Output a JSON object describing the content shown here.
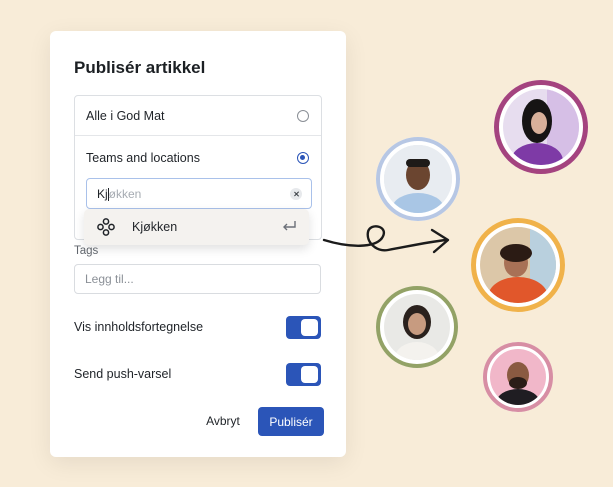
{
  "dialog": {
    "title": "Publisér artikkel",
    "audience_options": [
      {
        "label": "Alle i God Mat",
        "selected": false
      },
      {
        "label": "Teams and locations",
        "selected": true
      }
    ],
    "search": {
      "typed": "Kj",
      "suggestion_rest": "økken"
    },
    "suggestion": {
      "label": "Kjøkken",
      "icon": "team-icon",
      "action_icon": "return-icon"
    },
    "tags": {
      "label": "Tags",
      "placeholder": "Legg til..."
    },
    "toggles": [
      {
        "label": "Vis innholdsfortegnelse",
        "on": true
      },
      {
        "label": "Send push-varsel",
        "on": true
      }
    ],
    "cancel_label": "Avbryt",
    "publish_label": "Publisér"
  },
  "colors": {
    "background": "#f8ecd8",
    "accent": "#2b55b8",
    "avatar_rings": [
      "#b7c7e4",
      "#a4437f",
      "#f0b24a",
      "#93a266",
      "#d78ea4"
    ]
  }
}
